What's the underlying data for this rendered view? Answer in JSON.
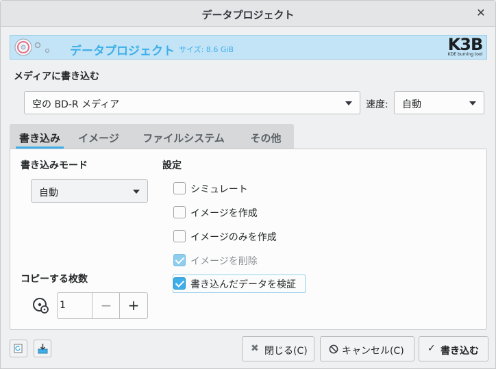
{
  "window": {
    "title": "データプロジェクト",
    "close_glyph": "✕"
  },
  "banner": {
    "project_name": "データプロジェクト",
    "size_text": "サイズ: 8.6 GiB",
    "logo_text": "K3B",
    "logo_tagline": "KDE burning tool",
    "icon": "optical-disc-icon"
  },
  "media": {
    "section_label": "メディアに書き込む",
    "selected_medium": "空の BD-R メディア",
    "speed_label": "速度:",
    "speed_value": "自動"
  },
  "tabs": [
    {
      "label": "書き込み",
      "active": true
    },
    {
      "label": "イメージ",
      "active": false
    },
    {
      "label": "ファイルシステム",
      "active": false
    },
    {
      "label": "その他",
      "active": false
    }
  ],
  "writing": {
    "mode_label": "書き込みモード",
    "mode_value": "自動",
    "copies_label": "コピーする枚数",
    "copies_value": "1",
    "copies_icon": "disc-copies-icon",
    "minus_glyph": "−",
    "plus_glyph": "+"
  },
  "settings": {
    "label": "設定",
    "options": [
      {
        "label": "シミュレート",
        "checked": false,
        "enabled": true
      },
      {
        "label": "イメージを作成",
        "checked": false,
        "enabled": true
      },
      {
        "label": "イメージのみを作成",
        "checked": false,
        "enabled": true
      },
      {
        "label": "イメージを削除",
        "checked": true,
        "enabled": false
      },
      {
        "label": "書き込んだデータを検証",
        "checked": true,
        "enabled": true
      }
    ]
  },
  "footer": {
    "close_label": "閉じる(C)",
    "close_icon": "close-x-icon",
    "cancel_label": "キャンセル(C)",
    "cancel_icon": "cancel-circle-icon",
    "burn_label": "書き込む",
    "burn_icon": "checkmark-icon",
    "left_buttons": [
      "reload-defaults-icon",
      "save-settings-icon"
    ]
  },
  "colors": {
    "accent": "#3daee9",
    "banner_bg": "#c3e4f7"
  }
}
